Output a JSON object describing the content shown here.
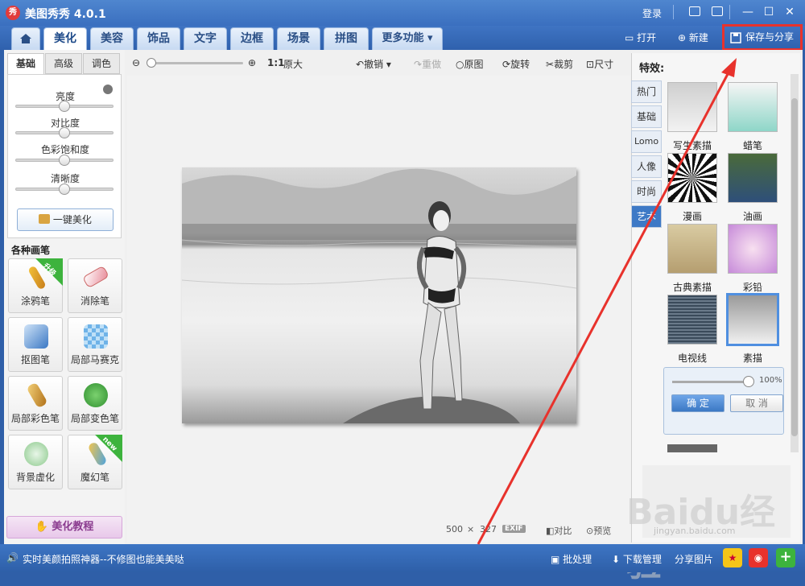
{
  "app": {
    "logo": "秀",
    "title": "美图秀秀 4.0.1",
    "login": "登录"
  },
  "nav": {
    "tabs": [
      {
        "label": "美化"
      },
      {
        "label": "美容"
      },
      {
        "label": "饰品"
      },
      {
        "label": "文字"
      },
      {
        "label": "边框"
      },
      {
        "label": "场景"
      },
      {
        "label": "拼图"
      },
      {
        "label": "更多功能 ▾"
      }
    ],
    "open": "打开",
    "new": "新建",
    "save_share": "保存与分享"
  },
  "left": {
    "subtabs": [
      "基础",
      "高级",
      "调色"
    ],
    "sliders": [
      {
        "label": "亮度",
        "value": 0.5
      },
      {
        "label": "对比度",
        "value": 0.5
      },
      {
        "label": "色彩饱和度",
        "value": 0.5
      },
      {
        "label": "清晰度",
        "value": 0.5
      }
    ],
    "one_key": "一键美化",
    "brush_title": "各种画笔",
    "tools": [
      {
        "label": "涂鸦笔",
        "badge": "升级"
      },
      {
        "label": "消除笔"
      },
      {
        "label": "抠图笔"
      },
      {
        "label": "局部马赛克"
      },
      {
        "label": "局部彩色笔"
      },
      {
        "label": "局部变色笔"
      },
      {
        "label": "背景虚化"
      },
      {
        "label": "魔幻笔",
        "badge": "new"
      }
    ],
    "tutorial": "美化教程"
  },
  "toolbar": {
    "ratio": "1:1",
    "original_size": "原大",
    "undo": "撤销",
    "redo": "重做",
    "origin": "原图",
    "rotate": "旋转",
    "crop": "裁剪",
    "size": "尺寸"
  },
  "canvas": {
    "width": "500",
    "x": "×",
    "height": "327",
    "exif": "EXIF",
    "compare": "对比",
    "preview": "预览"
  },
  "effects": {
    "title": "特效:",
    "categories": [
      "热门",
      "基础",
      "Lomo",
      "人像",
      "时尚",
      "艺术"
    ],
    "items": [
      {
        "label": "写生素描"
      },
      {
        "label": "蜡笔"
      },
      {
        "label": "漫画"
      },
      {
        "label": "油画"
      },
      {
        "label": "古典素描"
      },
      {
        "label": "彩铅"
      },
      {
        "label": "电视线"
      },
      {
        "label": "素描"
      }
    ],
    "percent": "100%",
    "ok": "确 定",
    "cancel": "取 消"
  },
  "status": {
    "text": "实时美颜拍照神器--不修图也能美美哒",
    "batch": "批处理",
    "download": "下载管理",
    "share": "分享图片"
  },
  "watermark": {
    "main": "Baidu经验",
    "sub": "jingyan.baidu.com"
  },
  "colors": {
    "accent": "#3a6fbf",
    "highlight": "#e8322c"
  }
}
